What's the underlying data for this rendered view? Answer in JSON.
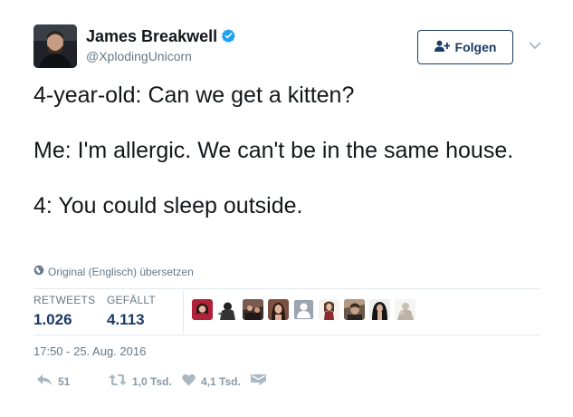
{
  "author": {
    "name": "James Breakwell",
    "handle": "@XplodingUnicorn",
    "verified": true
  },
  "follow_button": {
    "label": "Folgen"
  },
  "tweet": {
    "paragraphs": [
      "4-year-old: Can we get a kitten?",
      "Me: I'm allergic. We can't be in the same house.",
      "4: You could sleep outside."
    ]
  },
  "translate_link": "Original (Englisch) übersetzen",
  "stats": {
    "retweets_label": "RETWEETS",
    "retweets_value": "1.026",
    "likes_label": "GEFÄLLT",
    "likes_value": "4.113"
  },
  "timestamp": "17:50 - 25. Aug. 2016",
  "actions": {
    "reply_count": "51",
    "retweet_count": "1,0 Tsd.",
    "like_count": "4,1 Tsd."
  },
  "colors": {
    "text": "#14171a",
    "secondary": "#657786",
    "accent": "#1b3a66",
    "verified": "#1da1f2",
    "divider": "#e1e8ed"
  },
  "icons": [
    "verified-badge-icon",
    "follow-user-icon",
    "chevron-down-icon",
    "globe-icon",
    "reply-icon",
    "retweet-icon",
    "heart-icon",
    "message-icon"
  ]
}
